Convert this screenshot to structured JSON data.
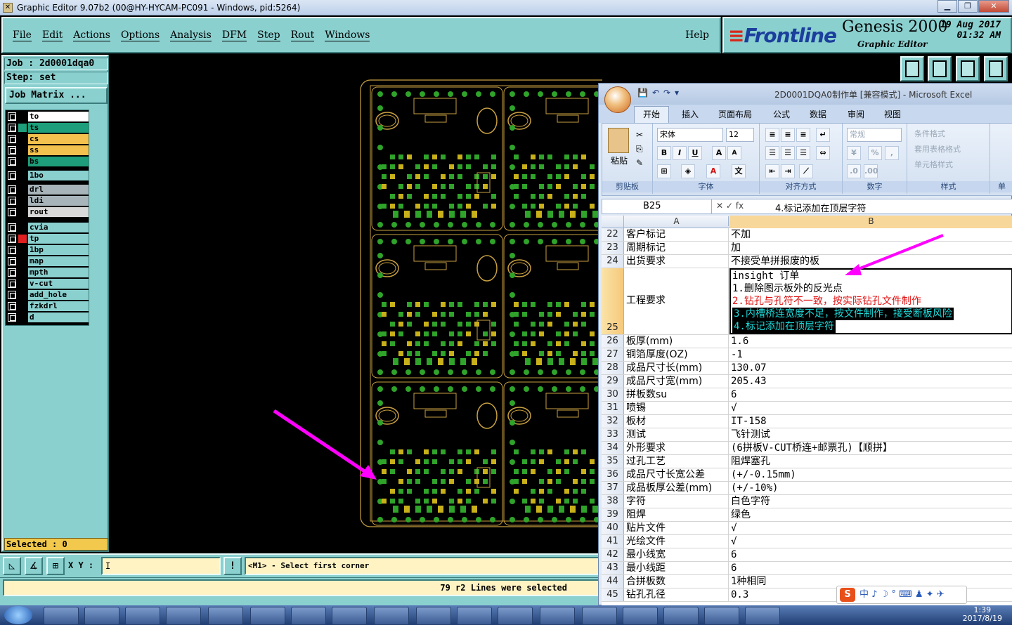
{
  "window": {
    "title": "Graphic Editor 9.07b2 (00@HY-HYCAM-PC091 - Windows, pid:5264)",
    "minimize": "▁",
    "restore": "❐",
    "close": "✕"
  },
  "menu": {
    "items": [
      "File",
      "Edit",
      "Actions",
      "Options",
      "Analysis",
      "DFM",
      "Step",
      "Rout",
      "Windows"
    ],
    "help": "Help"
  },
  "brand": {
    "logo": "Frontline",
    "product": "Genesis 2000",
    "subtitle": "Graphic Editor",
    "date": "19 Aug 2017",
    "time": "01:32 AM"
  },
  "left_panel": {
    "job": "Job : 2d0001dqa0",
    "step": "Step: set",
    "job_matrix": "Job Matrix ...",
    "layers": [
      {
        "name": "to",
        "color": "#ffffff",
        "swatch": "#000000"
      },
      {
        "name": "ts",
        "color": "#1e9e7a",
        "swatch": "#1e9e7a"
      },
      {
        "name": "cs",
        "color": "#f2c14e",
        "swatch": "#000000"
      },
      {
        "name": "ss",
        "color": "#f2c14e",
        "swatch": "#000000"
      },
      {
        "name": "bs",
        "color": "#1e9e7a",
        "swatch": "#000000"
      },
      {
        "name": "1bo",
        "color": "#8ad0cf",
        "swatch": "#000000"
      },
      {
        "name": "drl",
        "color": "#a7b4ba",
        "swatch": "#000000"
      },
      {
        "name": "ldi",
        "color": "#a7b4ba",
        "swatch": "#000000"
      },
      {
        "name": "rout",
        "color": "#d8d8d8",
        "swatch": "#000000"
      },
      {
        "name": "cvia",
        "color": "#8ad0cf",
        "swatch": "#000000"
      },
      {
        "name": "tp",
        "color": "#8ad0cf",
        "swatch": "#e02020"
      },
      {
        "name": "1bp",
        "color": "#8ad0cf",
        "swatch": "#000000"
      },
      {
        "name": "map",
        "color": "#8ad0cf",
        "swatch": "#000000"
      },
      {
        "name": "mpth",
        "color": "#8ad0cf",
        "swatch": "#000000"
      },
      {
        "name": "v-cut",
        "color": "#8ad0cf",
        "swatch": "#000000"
      },
      {
        "name": "add_hole",
        "color": "#8ad0cf",
        "swatch": "#000000"
      },
      {
        "name": "fzkdrl",
        "color": "#8ad0cf",
        "swatch": "#000000"
      },
      {
        "name": "d",
        "color": "#8ad0cf",
        "swatch": "#000000"
      }
    ],
    "selected": "Selected : 0"
  },
  "bottom": {
    "xy_label": "X Y :",
    "xy_value": "I",
    "warn_icon": "!",
    "prompt": "<M1> - Select first corner",
    "status": "79 r2 Lines were selected"
  },
  "excel": {
    "title": "2D0001DQA0制作单 [兼容模式] - Microsoft Excel",
    "tabs": [
      "开始",
      "插入",
      "页面布局",
      "公式",
      "数据",
      "审阅",
      "视图"
    ],
    "active_tab": "开始",
    "groups": {
      "clipboard": "剪贴板",
      "paste": "粘贴",
      "font": "字体",
      "align": "对齐方式",
      "number": "数字",
      "style": "样式",
      "cells": "单"
    },
    "font_name": "宋体",
    "font_size": "12",
    "number_format": "常规",
    "style_items": [
      "条件格式",
      "套用表格格式",
      "单元格样式"
    ],
    "name_box": "B25",
    "formula": "4.标记添加在顶层字符",
    "col_a": "A",
    "col_b": "B",
    "rows": [
      {
        "n": "22",
        "a": "客户标记",
        "b": "不加"
      },
      {
        "n": "23",
        "a": "周期标记",
        "b": "加"
      },
      {
        "n": "24",
        "a": "出货要求",
        "b": "不接受单拼报废的板"
      },
      {
        "n": "25",
        "a": "工程要求",
        "lines": [
          {
            "text": "insight 订单",
            "style": "normal"
          },
          {
            "text": "1.删除图示板外的反光点",
            "style": "normal"
          },
          {
            "text": "2.钻孔与孔符不一致，按实际钻孔文件制作",
            "style": "red"
          },
          {
            "text": "3.内槽桥连宽度不足，按文件制作，接受断板风险",
            "style": "hl"
          },
          {
            "text": "4.标记添加在顶层字符",
            "style": "hl"
          }
        ]
      },
      {
        "n": "26",
        "a": "板厚(mm)",
        "b": "1.6"
      },
      {
        "n": "27",
        "a": "铜箔厚度(OZ)",
        "b": "-1"
      },
      {
        "n": "28",
        "a": "成品尺寸长(mm)",
        "b": "130.07"
      },
      {
        "n": "29",
        "a": "成品尺寸宽(mm)",
        "b": "205.43"
      },
      {
        "n": "30",
        "a": "拼板数su",
        "b": "6"
      },
      {
        "n": "31",
        "a": "喷锡",
        "b": "√"
      },
      {
        "n": "32",
        "a": "板材",
        "b": "IT-158"
      },
      {
        "n": "33",
        "a": "测试",
        "b": "飞针测试"
      },
      {
        "n": "34",
        "a": "外形要求",
        "b": "(6拼板V-CUT桥连+邮票孔)【顺拼】"
      },
      {
        "n": "35",
        "a": "过孔工艺",
        "b": "阻焊塞孔"
      },
      {
        "n": "36",
        "a": "成品尺寸长宽公差",
        "b": "(+/-0.15mm)"
      },
      {
        "n": "37",
        "a": "成品板厚公差(mm)",
        "b": "(+/-10%)"
      },
      {
        "n": "38",
        "a": "字符",
        "b": "白色字符"
      },
      {
        "n": "39",
        "a": "阻焊",
        "b": "绿色"
      },
      {
        "n": "40",
        "a": "贴片文件",
        "b": "√"
      },
      {
        "n": "41",
        "a": "光绘文件",
        "b": "√"
      },
      {
        "n": "42",
        "a": "最小线宽",
        "b": "6"
      },
      {
        "n": "43",
        "a": "最小线距",
        "b": "6"
      },
      {
        "n": "44",
        "a": "合拼板数",
        "b": "1种相同"
      },
      {
        "n": "45",
        "a": "钻孔孔径",
        "b": "0.3"
      }
    ]
  },
  "ime": {
    "logo": "S",
    "text": "中 ♪ ☽ ° ⌨ ♟ ✦ ✈"
  },
  "taskbar": {
    "time": "1:39",
    "date": "2017/8/19"
  },
  "colors": {
    "panel": "#8ad0cf",
    "pcb_outline": "#c8a040",
    "pad_green": "#2fa32a",
    "pad_yellow": "#c8b01a",
    "arrow": "#ff00ff"
  }
}
